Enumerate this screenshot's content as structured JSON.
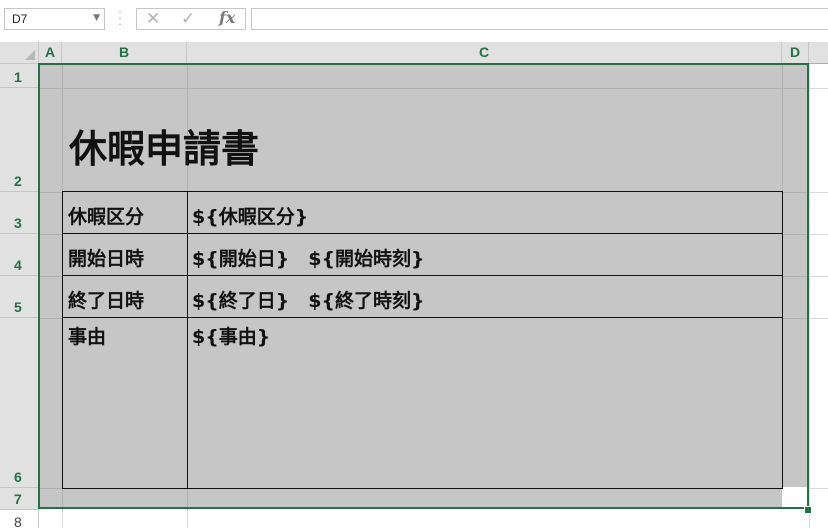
{
  "formula_bar": {
    "name_box": "D7",
    "cancel_icon": "✕",
    "enter_icon": "✓",
    "function_icon": "fx",
    "formula": ""
  },
  "columns": [
    "A",
    "B",
    "C",
    "D"
  ],
  "rows": [
    "1",
    "2",
    "3",
    "4",
    "5",
    "6",
    "7",
    "8"
  ],
  "sheet": {
    "title": "休暇申請書",
    "table": [
      {
        "label": "休暇区分",
        "value": "${休暇区分}"
      },
      {
        "label": "開始日時",
        "value": "${開始日}　${開始時刻}"
      },
      {
        "label": "終了日時",
        "value": "${終了日}　${終了時刻}"
      },
      {
        "label": "事由",
        "value": "${事由}"
      }
    ]
  },
  "colors": {
    "accent": "#217346",
    "header_bg": "#e1e1e1",
    "selection_bg": "#c6c6c6"
  }
}
